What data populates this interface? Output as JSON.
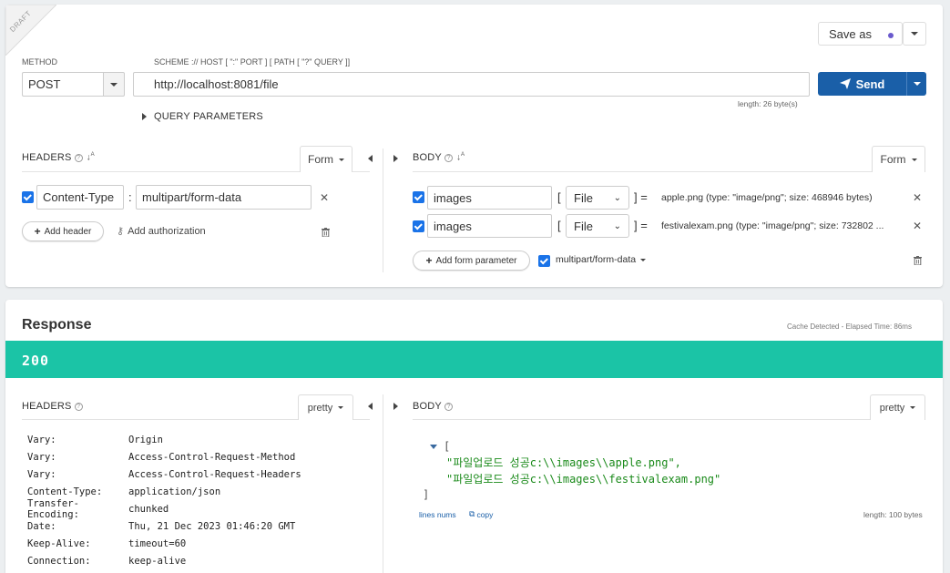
{
  "request": {
    "draft_label": "DRAFT",
    "save_as_label": "Save as",
    "method_label": "METHOD",
    "method_value": "POST",
    "scheme_label": "SCHEME :// HOST [ \":\" PORT ] [ PATH [ \"?\" QUERY ]]",
    "url_value": "http://localhost:8081/file",
    "url_length": "length: 26 byte(s)",
    "send_label": "Send",
    "query_params_label": "QUERY PARAMETERS",
    "headers_title": "HEADERS",
    "headers_mode": "Form",
    "header_name": "Content-Type",
    "header_colon": ":",
    "header_value": "multipart/form-data",
    "add_header_label": "Add header",
    "add_authorization_label": "Add authorization",
    "body_title": "BODY",
    "body_mode": "Form",
    "body_params": [
      {
        "name": "images",
        "type": "File",
        "file": "apple.png (type: \"image/png\"; size: 468946 bytes)"
      },
      {
        "name": "images",
        "type": "File",
        "file": "festivalexam.png (type: \"image/png\"; size: 732802 ..."
      }
    ],
    "bracket_open": "[",
    "bracket_close_eq": "] =",
    "add_form_parameter_label": "Add form parameter",
    "encoding_label": "multipart/form-data"
  },
  "response": {
    "title": "Response",
    "cache_info": "Cache Detected - Elapsed Time: 86ms",
    "status_code": "200",
    "headers_title": "HEADERS",
    "headers_mode": "pretty",
    "headers": [
      {
        "k": "Vary:",
        "v": "Origin"
      },
      {
        "k": "Vary:",
        "v": "Access-Control-Request-Method"
      },
      {
        "k": "Vary:",
        "v": "Access-Control-Request-Headers"
      },
      {
        "k": "Content-Type:",
        "v": "application/json"
      },
      {
        "k": "Transfer-Encoding:",
        "v": "chunked"
      },
      {
        "k": "Date:",
        "v": "Thu, 21 Dec 2023 01:46:20 GMT"
      },
      {
        "k": "Keep-Alive:",
        "v": "timeout=60"
      },
      {
        "k": "Connection:",
        "v": "keep-alive"
      }
    ],
    "body_title": "BODY",
    "body_mode": "pretty",
    "json_open": "[",
    "json_lines": [
      "\"파일업로드 성공c:\\\\images\\\\apple.png\",",
      "\"파일업로드 성공c:\\\\images\\\\festivalexam.png\""
    ],
    "json_close": "]",
    "lines_nums_label": "lines nums",
    "copy_label": "copy",
    "body_length": "length: 100 bytes"
  },
  "colors": {
    "accent": "#1a5fa8",
    "status_ok": "#1bc4a6",
    "json_string": "#1a8a1a"
  }
}
